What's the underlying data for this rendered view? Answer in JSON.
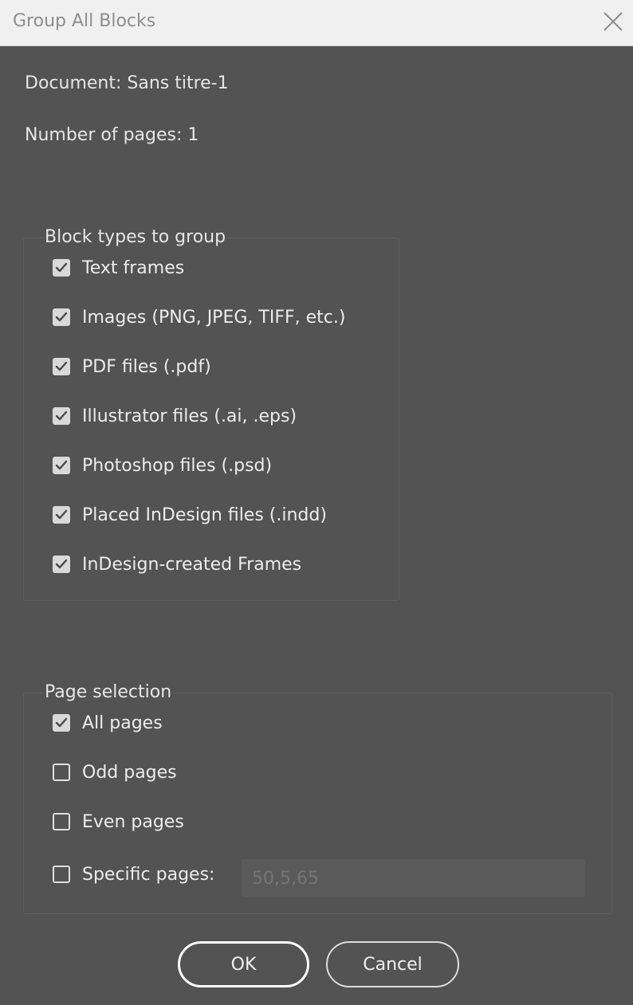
{
  "window": {
    "title": "Group All Blocks"
  },
  "info": {
    "document": "Document: Sans titre-1",
    "pages_count": "Number of pages: 1"
  },
  "block_types": {
    "legend": "Block types to group",
    "items": [
      {
        "label": "Text frames",
        "checked": true
      },
      {
        "label": "Images (PNG, JPEG, TIFF, etc.)",
        "checked": true
      },
      {
        "label": "PDF files (.pdf)",
        "checked": true
      },
      {
        "label": "Illustrator files (.ai, .eps)",
        "checked": true
      },
      {
        "label": "Photoshop files (.psd)",
        "checked": true
      },
      {
        "label": "Placed InDesign files (.indd)",
        "checked": true
      },
      {
        "label": "InDesign-created Frames",
        "checked": true
      }
    ]
  },
  "page_selection": {
    "legend": "Page selection",
    "items": [
      {
        "label": "All pages",
        "checked": true
      },
      {
        "label": "Odd pages",
        "checked": false
      },
      {
        "label": "Even pages",
        "checked": false
      },
      {
        "label": "Specific pages:",
        "checked": false
      }
    ],
    "specific_pages_placeholder": "50,5,65"
  },
  "buttons": {
    "ok": "OK",
    "cancel": "Cancel"
  },
  "icons": {
    "close": "close-icon",
    "checkbox_checked": "checkmark-icon"
  },
  "colors": {
    "dialog_bg": "#535353",
    "titlebar_bg": "#f0f0f0",
    "checkbox_fill": "#d9d9d9"
  }
}
